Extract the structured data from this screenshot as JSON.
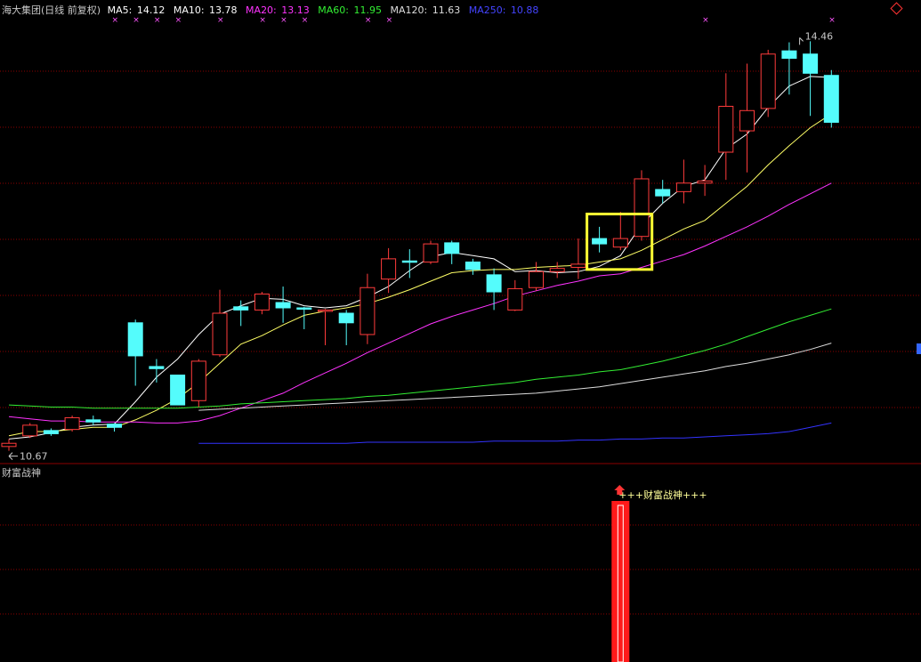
{
  "header": {
    "title": "海大集团(日线 前复权)",
    "ma5_label": "MA5:",
    "ma5_value": "14.12",
    "ma10_label": "MA10:",
    "ma10_value": "13.78",
    "ma20_label": "MA20:",
    "ma20_value": "13.13",
    "ma60_label": "MA60:",
    "ma60_value": "11.95",
    "ma120_label": "MA120:",
    "ma120_value": "11.63",
    "ma250_label": "MA250:",
    "ma250_value": "10.88"
  },
  "colors": {
    "background": "#000000",
    "grid": "#8b0000",
    "up": "#ff3b3b",
    "down": "#54fcfc",
    "ma5": "#ffffff",
    "ma10": "#ffff66",
    "ma20": "#ff33ff",
    "ma60": "#33ee33",
    "ma120": "#dddddd",
    "ma250": "#3333ff",
    "highlight": "#ffff33",
    "signal": "#ff1a1a",
    "text": "#c8c8c8",
    "marker": "#ff55ff"
  },
  "price_labels": {
    "high": "14.46",
    "low": "10.67"
  },
  "lower_panel": {
    "title": "财富战神",
    "signal_label": "+++财富战神+++",
    "signal_index": 29
  },
  "chart_data": {
    "type": "candlestick",
    "x": [
      1,
      2,
      3,
      4,
      5,
      6,
      7,
      8,
      9,
      10,
      11,
      12,
      13,
      14,
      15,
      16,
      17,
      18,
      19,
      20,
      21,
      22,
      23,
      24,
      25,
      26,
      27,
      28,
      29,
      30,
      31,
      32,
      33,
      34,
      35,
      36,
      37,
      38,
      39,
      40
    ],
    "candles": [
      {
        "open": 10.66,
        "close": 10.69,
        "high": 10.73,
        "low": 10.62
      },
      {
        "open": 10.76,
        "close": 10.86,
        "high": 10.88,
        "low": 10.74
      },
      {
        "open": 10.81,
        "close": 10.78,
        "high": 10.83,
        "low": 10.76
      },
      {
        "open": 10.82,
        "close": 10.93,
        "high": 10.95,
        "low": 10.8
      },
      {
        "open": 10.91,
        "close": 10.89,
        "high": 10.95,
        "low": 10.86
      },
      {
        "open": 10.87,
        "close": 10.84,
        "high": 10.88,
        "low": 10.8
      },
      {
        "open": 11.82,
        "close": 11.51,
        "high": 11.85,
        "low": 11.23
      },
      {
        "open": 11.41,
        "close": 11.39,
        "high": 11.48,
        "low": 11.26
      },
      {
        "open": 11.33,
        "close": 11.05,
        "high": 11.33,
        "low": 11.05
      },
      {
        "open": 11.09,
        "close": 11.46,
        "high": 11.48,
        "low": 11.03
      },
      {
        "open": 11.52,
        "close": 11.91,
        "high": 12.13,
        "low": 11.5
      },
      {
        "open": 11.97,
        "close": 11.94,
        "high": 12.03,
        "low": 11.79
      },
      {
        "open": 11.94,
        "close": 12.09,
        "high": 12.11,
        "low": 11.9
      },
      {
        "open": 12.01,
        "close": 11.96,
        "high": 12.16,
        "low": 11.82
      },
      {
        "open": 11.96,
        "close": 11.95,
        "high": 11.97,
        "low": 11.76
      },
      {
        "open": 11.93,
        "close": 11.94,
        "high": 11.95,
        "low": 11.61
      },
      {
        "open": 11.91,
        "close": 11.82,
        "high": 11.94,
        "low": 11.61
      },
      {
        "open": 11.71,
        "close": 12.15,
        "high": 12.28,
        "low": 11.62
      },
      {
        "open": 12.23,
        "close": 12.42,
        "high": 12.52,
        "low": 12.1
      },
      {
        "open": 12.4,
        "close": 12.39,
        "high": 12.51,
        "low": 12.24
      },
      {
        "open": 12.39,
        "close": 12.56,
        "high": 12.59,
        "low": 12.37
      },
      {
        "open": 12.57,
        "close": 12.47,
        "high": 12.59,
        "low": 12.37
      },
      {
        "open": 12.39,
        "close": 12.32,
        "high": 12.42,
        "low": 12.27
      },
      {
        "open": 12.27,
        "close": 12.11,
        "high": 12.33,
        "low": 11.94
      },
      {
        "open": 11.94,
        "close": 12.14,
        "high": 12.22,
        "low": 11.93
      },
      {
        "open": 12.15,
        "close": 12.3,
        "high": 12.39,
        "low": 12.12
      },
      {
        "open": 12.3,
        "close": 12.33,
        "high": 12.39,
        "low": 12.24
      },
      {
        "open": 12.34,
        "close": 12.37,
        "high": 12.61,
        "low": 12.23
      },
      {
        "open": 12.61,
        "close": 12.56,
        "high": 12.72,
        "low": 12.48
      },
      {
        "open": 12.53,
        "close": 12.61,
        "high": 12.86,
        "low": 12.5
      },
      {
        "open": 12.63,
        "close": 13.17,
        "high": 13.25,
        "low": 12.59
      },
      {
        "open": 13.07,
        "close": 13.01,
        "high": 13.16,
        "low": 12.94
      },
      {
        "open": 13.05,
        "close": 13.13,
        "high": 13.35,
        "low": 12.94
      },
      {
        "open": 13.13,
        "close": 13.15,
        "high": 13.3,
        "low": 13.01
      },
      {
        "open": 13.42,
        "close": 13.85,
        "high": 14.16,
        "low": 13.16
      },
      {
        "open": 13.62,
        "close": 13.81,
        "high": 14.25,
        "low": 13.23
      },
      {
        "open": 13.83,
        "close": 14.34,
        "high": 14.38,
        "low": 13.75
      },
      {
        "open": 14.37,
        "close": 14.3,
        "high": 14.45,
        "low": 13.96
      },
      {
        "open": 14.34,
        "close": 14.16,
        "high": 14.46,
        "low": 13.76
      },
      {
        "open": 14.14,
        "close": 13.7,
        "high": 14.19,
        "low": 13.65
      }
    ],
    "series": [
      {
        "name": "MA5",
        "values": [
          10.73,
          10.75,
          10.79,
          10.84,
          10.86,
          10.87,
          11.08,
          11.31,
          11.48,
          11.71,
          11.9,
          11.98,
          12.05,
          12.04,
          11.98,
          11.96,
          11.98,
          12.06,
          12.16,
          12.31,
          12.44,
          12.48,
          12.45,
          12.42,
          12.3,
          12.31,
          12.29,
          12.3,
          12.35,
          12.45,
          12.74,
          12.94,
          13.1,
          13.16,
          13.45,
          13.59,
          13.84,
          14.04,
          14.13,
          14.12
        ]
      },
      {
        "name": "MA10",
        "values": [
          10.76,
          10.8,
          10.8,
          10.82,
          10.84,
          10.84,
          10.91,
          11.0,
          11.11,
          11.26,
          11.44,
          11.62,
          11.7,
          11.8,
          11.89,
          11.93,
          11.96,
          12.0,
          12.06,
          12.13,
          12.21,
          12.29,
          12.31,
          12.32,
          12.32,
          12.34,
          12.35,
          12.36,
          12.39,
          12.42,
          12.5,
          12.6,
          12.7,
          12.78,
          12.94,
          13.1,
          13.3,
          13.48,
          13.65,
          13.78
        ]
      },
      {
        "name": "MA20",
        "values": [
          10.94,
          10.92,
          10.9,
          10.9,
          10.89,
          10.89,
          10.89,
          10.88,
          10.88,
          10.9,
          10.95,
          11.02,
          11.09,
          11.16,
          11.26,
          11.35,
          11.44,
          11.54,
          11.63,
          11.72,
          11.81,
          11.88,
          11.94,
          12.0,
          12.07,
          12.12,
          12.17,
          12.21,
          12.26,
          12.28,
          12.34,
          12.4,
          12.46,
          12.54,
          12.63,
          12.72,
          12.82,
          12.93,
          13.03,
          13.13
        ]
      },
      {
        "name": "MA60",
        "values": [
          11.05,
          11.04,
          11.03,
          11.03,
          11.02,
          11.02,
          11.02,
          11.02,
          11.02,
          11.03,
          11.04,
          11.06,
          11.07,
          11.08,
          11.09,
          11.1,
          11.11,
          11.13,
          11.14,
          11.16,
          11.18,
          11.2,
          11.22,
          11.24,
          11.26,
          11.29,
          11.31,
          11.33,
          11.36,
          11.38,
          11.42,
          11.46,
          11.51,
          11.56,
          11.62,
          11.69,
          11.76,
          11.83,
          11.89,
          11.95
        ]
      },
      {
        "name": "MA120",
        "values": [
          null,
          null,
          null,
          null,
          null,
          null,
          null,
          null,
          null,
          11.0,
          11.01,
          11.02,
          11.03,
          11.04,
          11.05,
          11.06,
          11.07,
          11.08,
          11.09,
          11.1,
          11.11,
          11.12,
          11.13,
          11.14,
          11.15,
          11.16,
          11.18,
          11.2,
          11.22,
          11.25,
          11.28,
          11.31,
          11.34,
          11.37,
          11.41,
          11.44,
          11.48,
          11.52,
          11.57,
          11.63
        ]
      },
      {
        "name": "MA250",
        "values": [
          null,
          null,
          null,
          null,
          null,
          null,
          null,
          null,
          null,
          10.69,
          10.69,
          10.69,
          10.69,
          10.69,
          10.69,
          10.69,
          10.69,
          10.7,
          10.7,
          10.7,
          10.7,
          10.7,
          10.7,
          10.71,
          10.71,
          10.71,
          10.71,
          10.72,
          10.72,
          10.73,
          10.73,
          10.74,
          10.74,
          10.75,
          10.76,
          10.77,
          10.78,
          10.8,
          10.84,
          10.88
        ]
      }
    ],
    "ylim": [
      10.55,
      14.68
    ],
    "highlight_range": [
      28,
      31
    ],
    "marker_indices": [
      5,
      6,
      7,
      8,
      10,
      12,
      13,
      14,
      17,
      18,
      33,
      39
    ],
    "lower_values": [
      0,
      0,
      0,
      0,
      0,
      0,
      0,
      0,
      0,
      0,
      0,
      0,
      0,
      0,
      0,
      0,
      0,
      0,
      0,
      0,
      0,
      0,
      0,
      0,
      0,
      0,
      0,
      0,
      0,
      1,
      0,
      0,
      0,
      0,
      0,
      0,
      0,
      0,
      0,
      0
    ],
    "grid": true
  }
}
